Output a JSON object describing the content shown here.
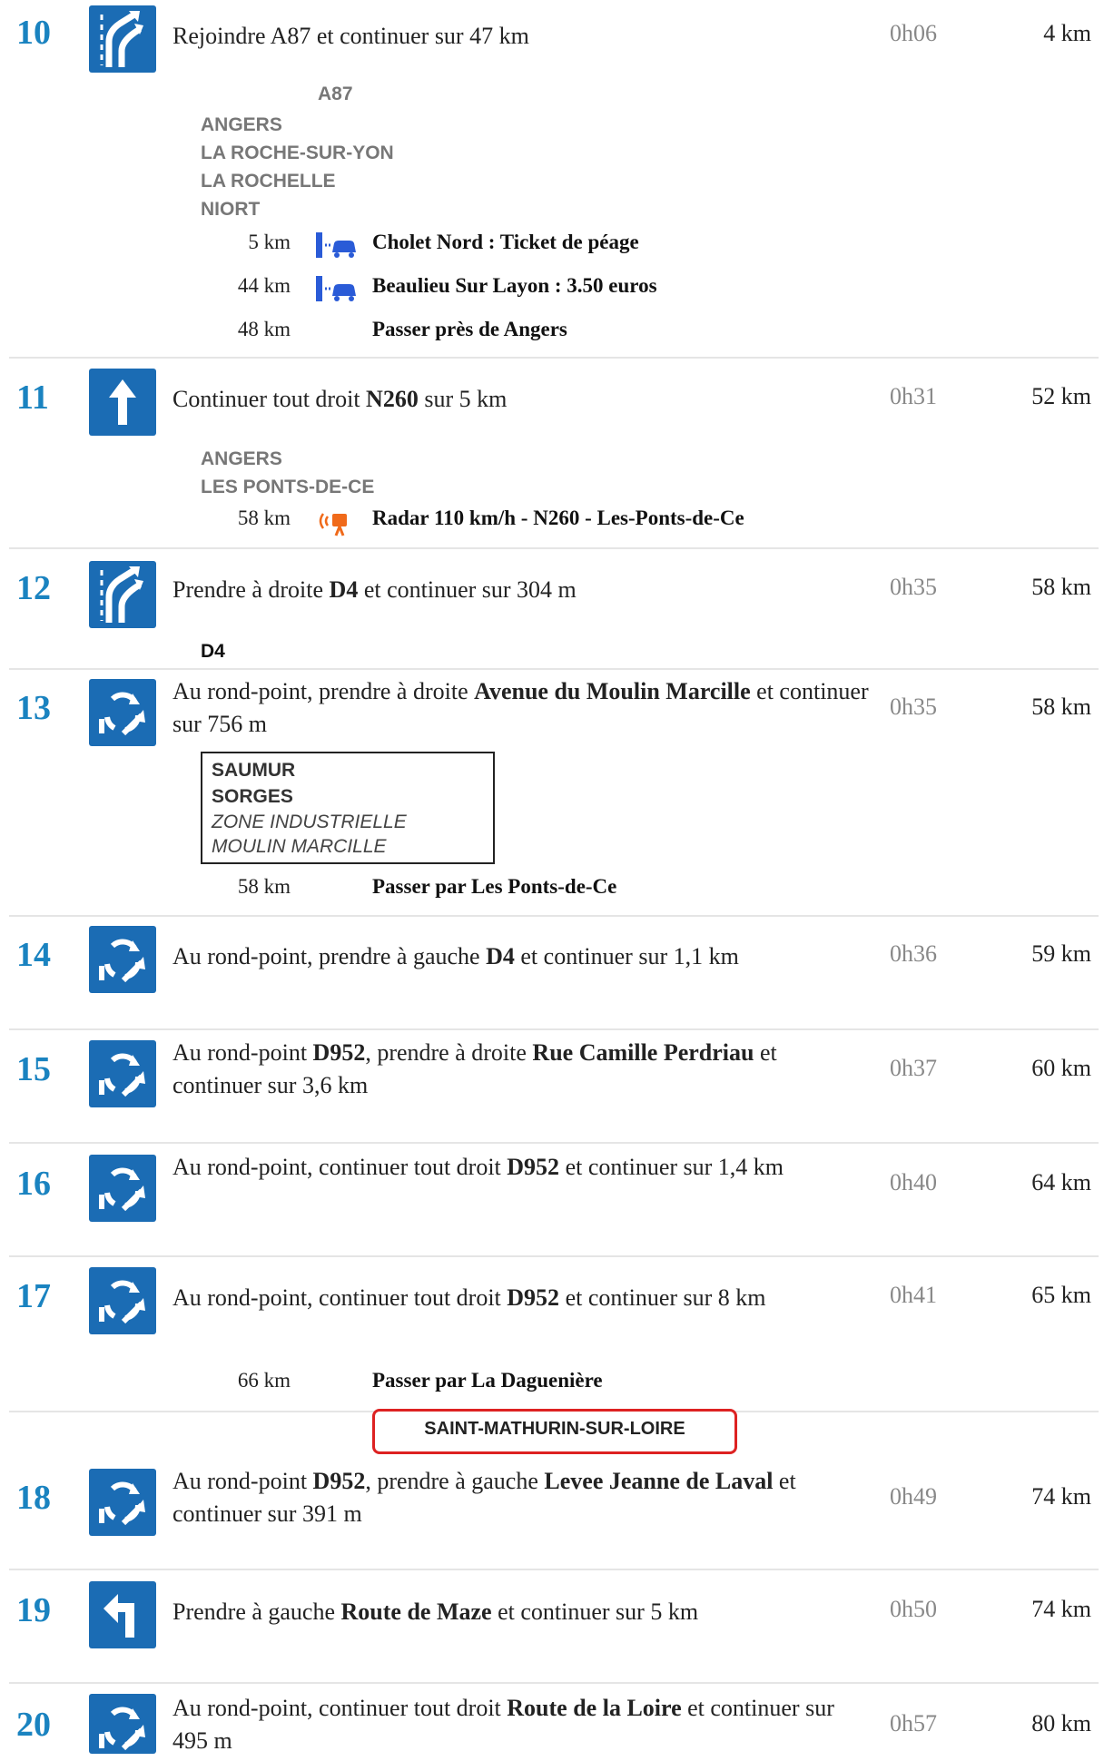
{
  "steps": [
    {
      "num": "10",
      "icon": "highway-merge-icon",
      "text_parts": [
        "Rejoindre A87 et continuer sur 47 km"
      ],
      "time": "0h06",
      "dist": "4 km",
      "sign_road": "A87",
      "sign_lines": [
        "ANGERS",
        "LA ROCHE-SUR-YON",
        "LA ROCHELLE",
        "NIORT"
      ],
      "subs": [
        {
          "km": "5 km",
          "icon": "toll-icon",
          "text": "Cholet Nord : Ticket de péage"
        },
        {
          "km": "44 km",
          "icon": "toll-icon",
          "text": "Beaulieu Sur Layon : 3.50 euros"
        },
        {
          "km": "48 km",
          "icon": "",
          "text": "Passer près de Angers"
        }
      ]
    },
    {
      "num": "11",
      "icon": "straight-arrow-icon",
      "pre": "Continuer tout droit ",
      "bold1": "N260",
      "post": " sur 5 km",
      "time": "0h31",
      "dist": "52 km",
      "sign_lines": [
        "ANGERS",
        "LES PONTS-DE-CE"
      ],
      "subs": [
        {
          "km": "58 km",
          "icon": "speed-camera-icon",
          "text": "Radar 110 km/h - N260 - Les-Ponts-de-Ce"
        }
      ]
    },
    {
      "num": "12",
      "icon": "highway-merge-icon",
      "pre": "Prendre à droite ",
      "bold1": "D4",
      "post": " et continuer sur 304 m",
      "time": "0h35",
      "dist": "58 km",
      "sign_road": "D4"
    },
    {
      "num": "13",
      "icon": "roundabout-icon",
      "pre": "Au rond-point, prendre à droite ",
      "bold1": "Avenue du Moulin Marcille",
      "post": " et continuer sur 756 m",
      "time": "0h35",
      "dist": "58 km",
      "box_bold": [
        "SAUMUR",
        "SORGES"
      ],
      "box_italic": [
        "ZONE INDUSTRIELLE",
        "MOULIN MARCILLE"
      ],
      "subs": [
        {
          "km": "58 km",
          "icon": "",
          "text": "Passer par Les Ponts-de-Ce"
        }
      ]
    },
    {
      "num": "14",
      "icon": "roundabout-icon",
      "pre": "Au rond-point, prendre à gauche ",
      "bold1": "D4",
      "post": " et continuer sur 1,1 km",
      "time": "0h36",
      "dist": "59 km"
    },
    {
      "num": "15",
      "icon": "roundabout-icon",
      "pre": "Au rond-point ",
      "bold1": "D952",
      "mid": ", prendre à droite ",
      "bold2": "Rue Camille Perdriau",
      "post": " et continuer sur 3,6 km",
      "time": "0h37",
      "dist": "60 km"
    },
    {
      "num": "16",
      "icon": "roundabout-icon",
      "pre": "Au rond-point, continuer tout droit ",
      "bold1": "D952",
      "post": " et continuer sur 1,4 km",
      "time": "0h40",
      "dist": "64 km"
    },
    {
      "num": "17",
      "icon": "roundabout-icon",
      "pre": "Au rond-point, continuer tout droit ",
      "bold1": "D952",
      "post": " et continuer sur 8 km",
      "time": "0h41",
      "dist": "65 km",
      "subs": [
        {
          "km": "66 km",
          "icon": "",
          "text": "Passer par La Daguenière"
        }
      ]
    },
    {
      "num": "18",
      "icon": "roundabout-icon",
      "pre": "Au rond-point ",
      "bold1": "D952",
      "mid": ", prendre à gauche ",
      "bold2": "Levee Jeanne de Laval",
      "post": " et continuer sur 391 m",
      "time": "0h49",
      "dist": "74 km",
      "town_sign": "SAINT-MATHURIN-SUR-LOIRE"
    },
    {
      "num": "19",
      "icon": "turn-left-arrow-icon",
      "pre": "Prendre à gauche ",
      "bold1": "Route de Maze",
      "post": " et continuer sur 5 km",
      "time": "0h50",
      "dist": "74 km"
    },
    {
      "num": "20",
      "icon": "roundabout-icon",
      "pre": "Au rond-point, continuer tout droit ",
      "bold1": "Route de la Loire",
      "post": " et continuer sur 495 m",
      "time": "0h57",
      "dist": "80 km"
    }
  ],
  "colors": {
    "step_number": "#1a83c0",
    "icon_bg": "#1b6cb4",
    "time": "#888888",
    "town_border": "#dd2222"
  }
}
